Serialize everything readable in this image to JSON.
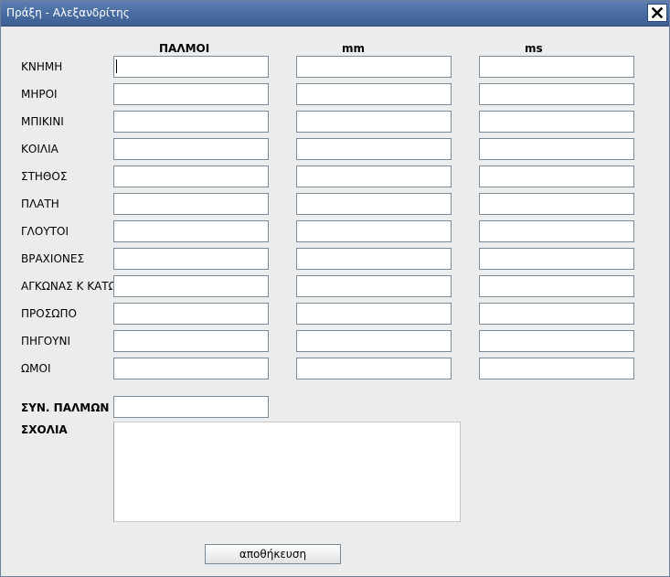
{
  "window": {
    "title": "Πράξη - Αλεξανδρίτης",
    "close_icon": "close-icon"
  },
  "columns": [
    "ΠΑΛΜΟΙ",
    "mm",
    "ms"
  ],
  "rows": [
    "ΚΝΗΜΗ",
    "ΜΗΡΟΙ",
    "ΜΠΙΚΙΝΙ",
    "ΚΟΙΛΙΑ",
    "ΣΤΗΘΟΣ",
    "ΠΛΑΤΗ",
    "ΓΛΟΥΤΟΙ",
    "ΒΡΑΧΙΟΝΕΣ",
    "ΑΓΚΩΝΑΣ Κ ΚΑΤΩ",
    "ΠΡΟΣΩΠΟ",
    "ΠΗΓΟΥΝΙ",
    "ΩΜΟΙ"
  ],
  "total_pulses": {
    "label": "ΣΥΝ. ΠΑΛΜΩΝ",
    "value": ""
  },
  "comments": {
    "label": "ΣΧΟΛΙΑ",
    "value": ""
  },
  "save_button": {
    "label": "αποθήκευση"
  }
}
